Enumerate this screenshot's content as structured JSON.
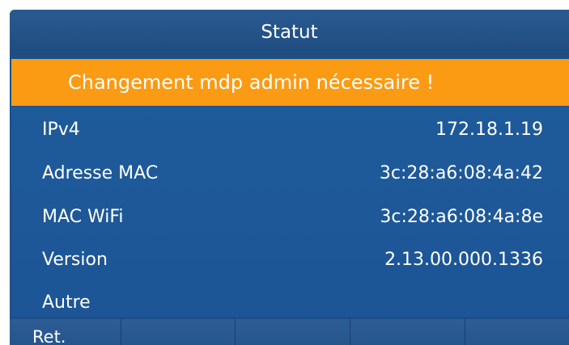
{
  "header": {
    "title": "Statut"
  },
  "warning": {
    "text": "Changement mdp admin nécessaire !"
  },
  "status_rows": [
    {
      "label": "IPv4",
      "value": "172.18.1.19"
    },
    {
      "label": "Adresse MAC",
      "value": "3c:28:a6:08:4a:42"
    },
    {
      "label": "MAC WiFi",
      "value": "3c:28:a6:08:4a:8e"
    },
    {
      "label": "Version",
      "value": "2.13.00.000.1336"
    },
    {
      "label": "Autre",
      "value": ""
    }
  ],
  "softkeys": [
    {
      "label": "Ret."
    },
    {
      "label": ""
    },
    {
      "label": ""
    },
    {
      "label": ""
    },
    {
      "label": ""
    }
  ],
  "colors": {
    "screen_background": "#1c4f86",
    "warning_background": "#fb9b14",
    "text": "#ffffff"
  }
}
